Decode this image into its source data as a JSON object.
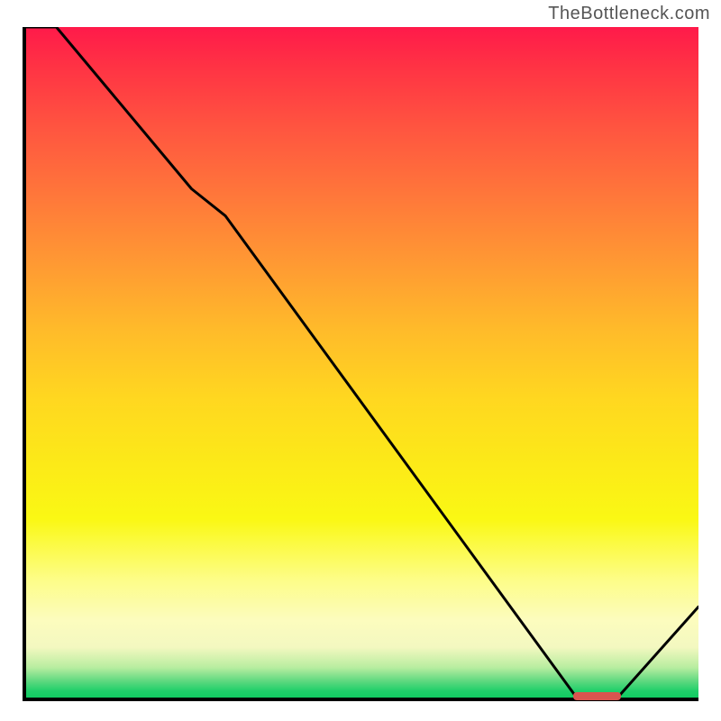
{
  "watermark": "TheBottleneck.com",
  "chart_data": {
    "type": "line",
    "title": "",
    "xlabel": "",
    "ylabel": "",
    "xlim": [
      0,
      100
    ],
    "ylim": [
      0,
      100
    ],
    "x": [
      0,
      5,
      25,
      30,
      82,
      88,
      100
    ],
    "values": [
      105,
      100,
      76,
      72,
      0.5,
      0.5,
      14
    ],
    "marker_segment_x": [
      82,
      88
    ],
    "grid": false,
    "legend": false
  },
  "colors": {
    "gradient_top": "#ff1a4a",
    "gradient_bottom": "#0ac95d",
    "curve": "#000000",
    "marker": "#d9544f",
    "axis": "#000000"
  }
}
